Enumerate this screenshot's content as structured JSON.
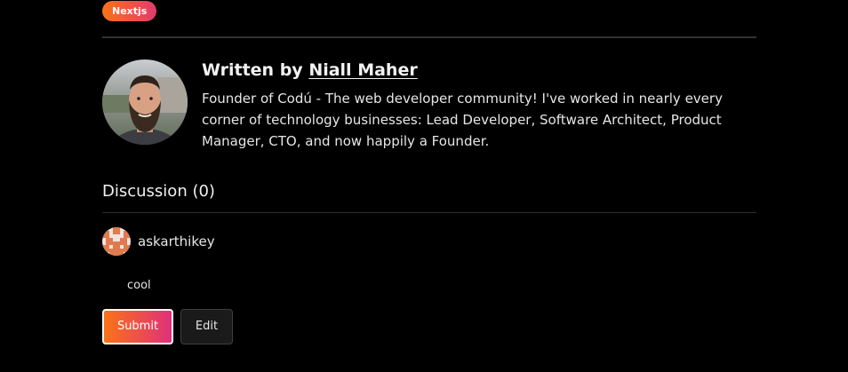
{
  "tags": [
    {
      "label": "Nextjs"
    }
  ],
  "author": {
    "written_by_prefix": "Written by",
    "name": "Niall Maher",
    "bio": "Founder of Codú - The web developer community! I've worked in nearly every corner of technology businesses: Lead Developer, Software Architect, Product Manager, CTO, and now happily a Founder.",
    "avatar_icon": "author-photo"
  },
  "discussion": {
    "title": "Discussion (0)",
    "user": {
      "username": "askarthikey",
      "avatar_icon": "pixel-avatar"
    },
    "comment_value": "cool",
    "submit_label": "Submit",
    "edit_label": "Edit"
  },
  "colors": {
    "background": "#000000",
    "accent_gradient_start": "#f97316",
    "accent_gradient_end": "#e23a6e",
    "divider": "#333333",
    "text": "#e6e6e6"
  }
}
